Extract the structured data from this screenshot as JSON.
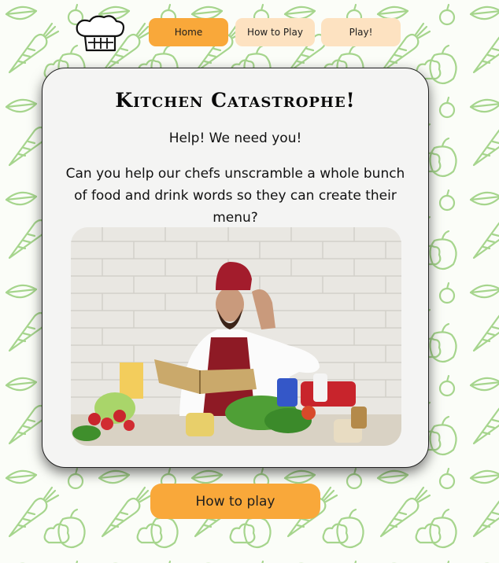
{
  "nav": {
    "home_label": "Home",
    "how_label": "How to Play",
    "play_label": "Play!"
  },
  "main": {
    "title": "Kitchen Catastrophe!",
    "subtitle": "Help! We need you!",
    "intro": "Can you help our chefs unscramble a whole bunch of food and drink words so they can create their menu?"
  },
  "cta": {
    "label": "How to play"
  },
  "icons": {
    "logo": "chef-hat-icon",
    "background": "vegetable-doodle-pattern"
  },
  "colors": {
    "accent": "#f9a83a",
    "accent_light": "#fde2c1",
    "pattern": "#a6d58d",
    "card": "#f4f4f3"
  }
}
